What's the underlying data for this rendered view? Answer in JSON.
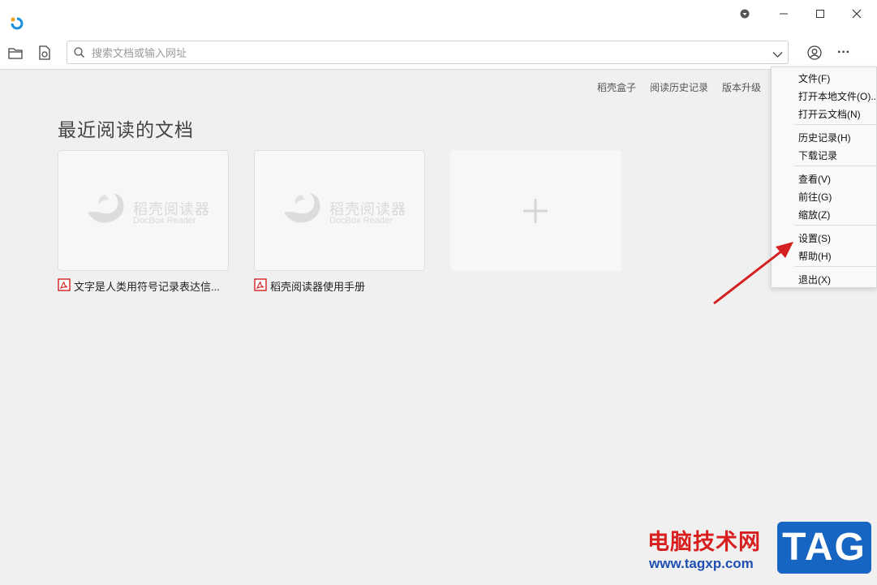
{
  "window": {
    "minimize_glyph": "—",
    "maximize_glyph": "☐",
    "close_glyph": "✕"
  },
  "toolbar": {
    "search_placeholder": "搜索文档或输入网址",
    "more_glyph": "···"
  },
  "top_links": [
    "稻壳盒子",
    "阅读历史记录",
    "版本升级"
  ],
  "section_title": "最近阅读的文档",
  "cards": [
    {
      "logo_cn": "稻壳阅读器",
      "logo_en": "DocBox Reader",
      "caption": "文字是人类用符号记录表达信..."
    },
    {
      "logo_cn": "稻壳阅读器",
      "logo_en": "DocBox Reader",
      "caption": "稻壳阅读器使用手册"
    }
  ],
  "menu": {
    "items": [
      "文件(F)",
      "打开本地文件(O)...",
      "打开云文档(N)",
      "历史记录(H)",
      "下载记录",
      "查看(V)",
      "前往(G)",
      "缩放(Z)",
      "设置(S)",
      "帮助(H)",
      "退出(X)"
    ]
  },
  "watermark": {
    "site_name": "电脑技术网",
    "url": "www.tagxp.com",
    "tag": "TAG"
  },
  "colors": {
    "accent": "#1765c2",
    "arrow": "#d42020",
    "pdf_red": "#d42020"
  }
}
